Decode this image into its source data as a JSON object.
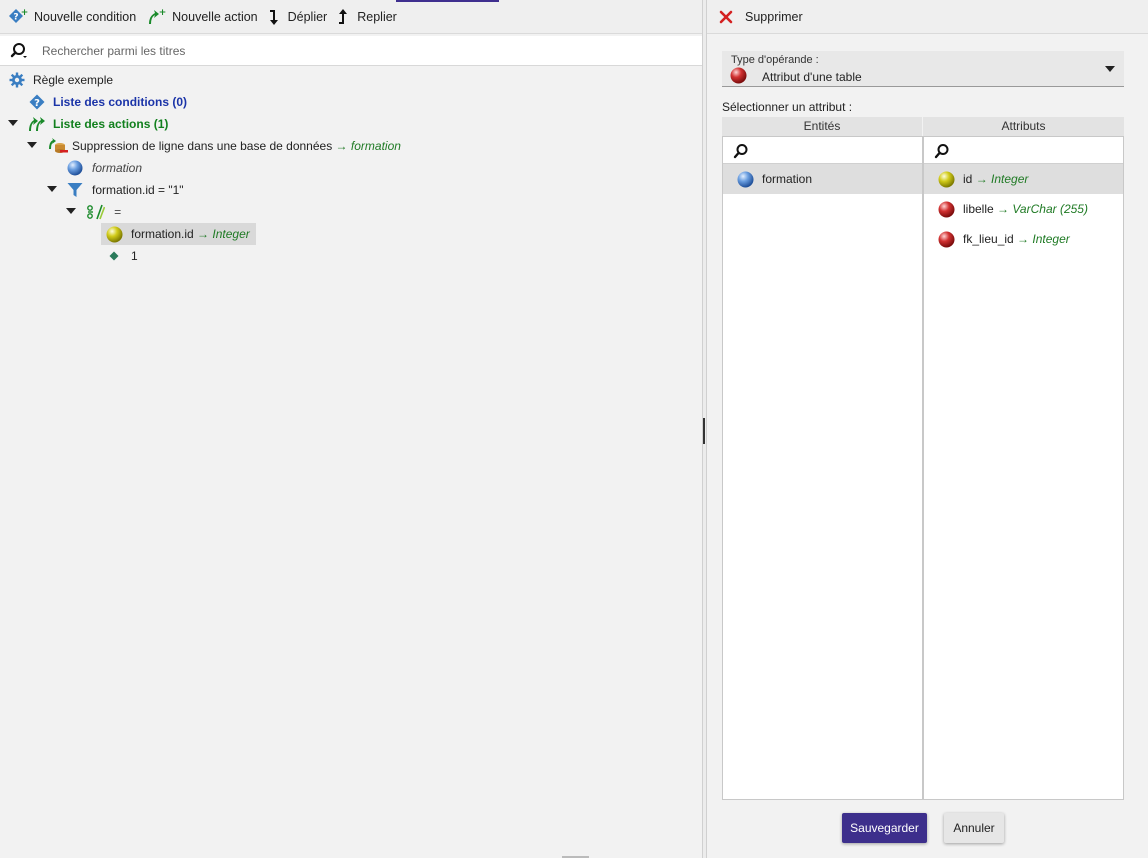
{
  "toolbar": {
    "new_condition": "Nouvelle condition",
    "new_action": "Nouvelle action",
    "expand": "Déplier",
    "collapse": "Replier"
  },
  "search": {
    "placeholder": "Rechercher parmi les titres"
  },
  "tree": {
    "rule": "Règle exemple",
    "conditions": "Liste des conditions (0)",
    "actions": "Liste des actions (1)",
    "action": {
      "label": "Suppression de ligne dans une base de données",
      "arrow": "→",
      "table": "formation"
    },
    "table_node": "formation",
    "filter": "formation.id = \"1\"",
    "operator": "=",
    "operand_attr": {
      "label": "formation.id",
      "arrow": "→",
      "type": "Integer"
    },
    "operand_value": "1"
  },
  "panel": {
    "delete": "Supprimer",
    "operand_type_caption": "Type d'opérande :",
    "operand_type_value": "Attribut d'une table",
    "select_attribute": "Sélectionner un attribut :",
    "entities_header": "Entités",
    "attributes_header": "Attributs",
    "entities": [
      {
        "label": "formation"
      }
    ],
    "attributes": [
      {
        "name": "id",
        "arrow": "→",
        "type": "Integer",
        "color": "#c8c200"
      },
      {
        "name": "libelle",
        "arrow": "→",
        "type": "VarChar (255)",
        "color": "#c81e1e"
      },
      {
        "name": "fk_lieu_id",
        "arrow": "→",
        "type": "Integer",
        "color": "#c81e1e"
      }
    ],
    "save": "Sauvegarder",
    "cancel": "Annuler"
  },
  "colors": {
    "accent": "#3d2f8c",
    "blue_link": "#1b34a8",
    "green_link": "#12801e",
    "type_text": "#1f7a24",
    "delete_red": "#d42020"
  }
}
